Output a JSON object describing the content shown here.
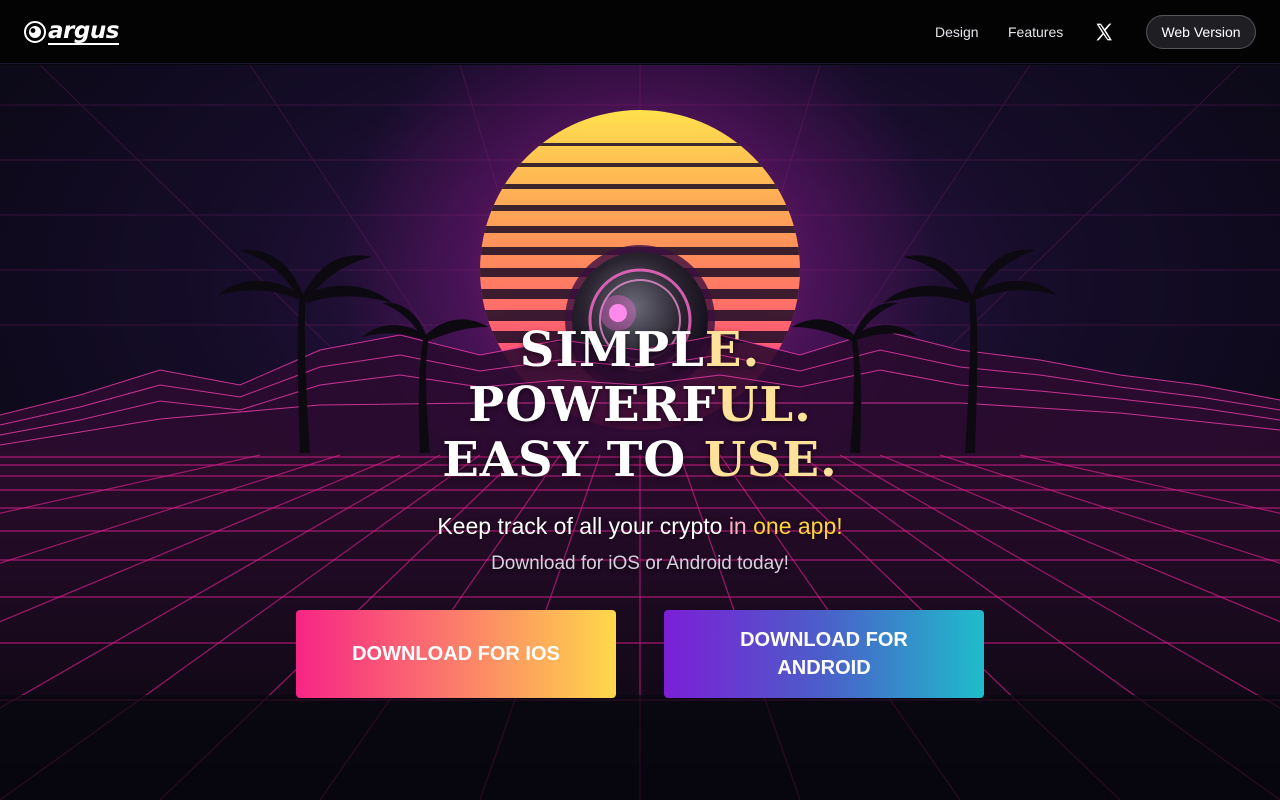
{
  "brand": {
    "name": "argus",
    "logo_icon": "argus-eye-icon"
  },
  "nav": {
    "design_label": "Design",
    "features_label": "Features",
    "x_icon": "x-logo-icon",
    "web_version_label": "Web Version"
  },
  "hero": {
    "headline": [
      {
        "plain": "SIMPL",
        "accent": "E."
      },
      {
        "plain": "POWERF",
        "accent": "UL."
      },
      {
        "plain": "EASY TO ",
        "accent": "USE."
      }
    ],
    "tagline_plain": "Keep track of all your crypto ",
    "tagline_in": "in ",
    "tagline_accent": "one app!",
    "subtagline": "Download for iOS or Android today!",
    "buttons": {
      "ios_label": "DOWNLOAD FOR IOS",
      "android_label": "DOWNLOAD FOR ANDROID"
    }
  },
  "colors": {
    "header_bg": "#030304",
    "accent_gold": "#ffe29a",
    "accent_yellow": "#ffd43b",
    "ios_gradient": [
      "#f72585",
      "#ffd84a"
    ],
    "android_gradient": [
      "#7b1fd6",
      "#1fbccb"
    ]
  }
}
